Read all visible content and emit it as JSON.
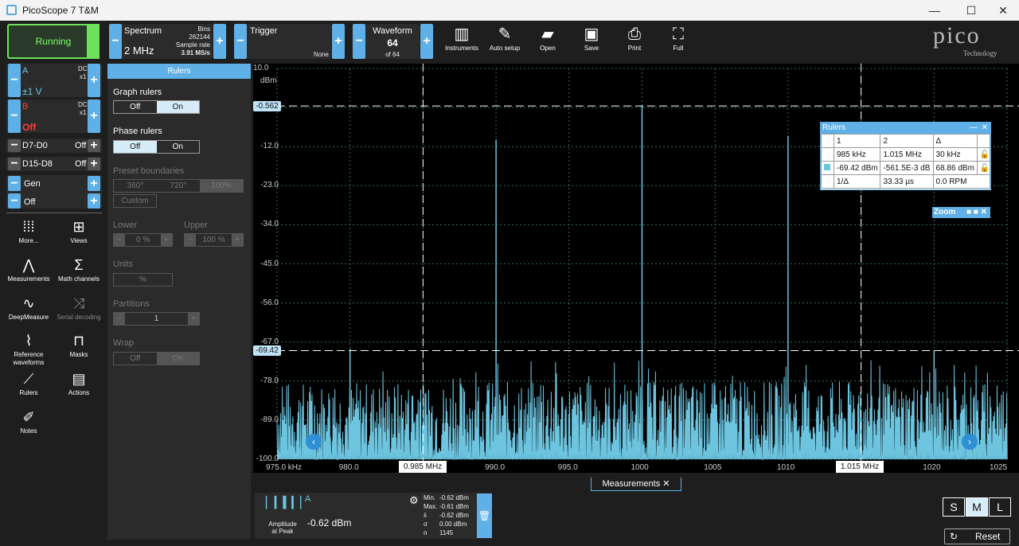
{
  "window": {
    "title": "PicoScope 7 T&M"
  },
  "toolbar": {
    "run_label": "Running",
    "spectrum": {
      "label": "Spectrum",
      "value": "2 MHz",
      "bins_label": "Bins",
      "bins_value": "262144",
      "rate_label": "Sample rate",
      "rate_value": "3.91 MS/s"
    },
    "trigger": {
      "label": "Trigger",
      "value": "None"
    },
    "waveform": {
      "label": "Waveform",
      "value": "64",
      "of": "of 64"
    },
    "tools": [
      "Instruments",
      "Auto setup",
      "Open",
      "Save",
      "Print",
      "Full"
    ]
  },
  "logo": {
    "brand": "pico",
    "sub": "Technology"
  },
  "channels": {
    "a": {
      "name": "A",
      "coupling": "DC",
      "probe": "x1",
      "range": "±1 V"
    },
    "b": {
      "name": "B",
      "coupling": "DC",
      "probe": "x1",
      "range": "Off"
    },
    "d7": {
      "name": "D7-D0",
      "state": "Off"
    },
    "d15": {
      "name": "D15-D8",
      "state": "Off"
    },
    "gen": {
      "name": "Gen",
      "state": "Off"
    }
  },
  "side_tools": [
    "More...",
    "Views",
    "Measurements",
    "Math channels",
    "DeepMeasure",
    "Serial decoding",
    "Reference waveforms",
    "Masks",
    "Rulers",
    "Actions",
    "Notes"
  ],
  "rulers_panel": {
    "title": "Rulers",
    "graph_rulers": "Graph rulers",
    "phase_rulers": "Phase rulers",
    "off": "Off",
    "on": "On",
    "preset_boundaries": "Preset boundaries",
    "presets": [
      "360°",
      "720°",
      "100%"
    ],
    "custom": "Custom",
    "lower": "Lower",
    "upper": "Upper",
    "lower_val": "0 %",
    "upper_val": "100 %",
    "units": "Units",
    "units_val": "%",
    "partitions": "Partitions",
    "partitions_val": "1",
    "wrap": "Wrap"
  },
  "plot": {
    "y_unit": "dBm",
    "y_ticks": [
      "10.0",
      "-1.0",
      "-12.0",
      "-23.0",
      "-34.0",
      "-45.0",
      "-56.0",
      "-67.0",
      "-78.0",
      "-89.0",
      "-100.0"
    ],
    "x_ticks": [
      "975.0 kHz",
      "980.0",
      "985.0",
      "990.0",
      "995.0",
      "1000",
      "1005",
      "1010",
      "1015",
      "1020",
      "1025"
    ],
    "ruler_h1": "-0.562",
    "ruler_h2": "-69.42",
    "ruler_v1": "0.985 MHz",
    "ruler_v2": "1.015 MHz",
    "trace_color": "#6cc4df",
    "peaks": [
      {
        "f": 990,
        "a": -10
      },
      {
        "f": 1000,
        "a": -0.562
      },
      {
        "f": 1010,
        "a": -9
      },
      {
        "f": 980,
        "a": -69
      },
      {
        "f": 1020,
        "a": -69.4
      }
    ]
  },
  "rulers_table": {
    "title": "Rulers",
    "cols": [
      "1",
      "2",
      "Δ"
    ],
    "row1": [
      "985 kHz",
      "1.015 MHz",
      "30 kHz"
    ],
    "row2": [
      "-69.42 dBm",
      "-561.5E-3 dB",
      "68.86 dBm"
    ],
    "row3": [
      "1/Δ",
      "33.33 µs",
      "0.0 RPM"
    ]
  },
  "zoom": {
    "title": "Zoom"
  },
  "measurements": {
    "tab": "Measurements",
    "channel": "A",
    "name": "Amplitude at Peak",
    "value": "-0.62 dBm",
    "stats": [
      [
        "Min.",
        "-0.62 dBm"
      ],
      [
        "Max.",
        "-0.61 dBm"
      ],
      [
        "x̄",
        "-0.62 dBm"
      ],
      [
        "σ",
        "0.00 dBm"
      ],
      [
        "n",
        "1145"
      ]
    ]
  },
  "size_buttons": [
    "S",
    "M",
    "L"
  ],
  "reset": "Reset"
}
